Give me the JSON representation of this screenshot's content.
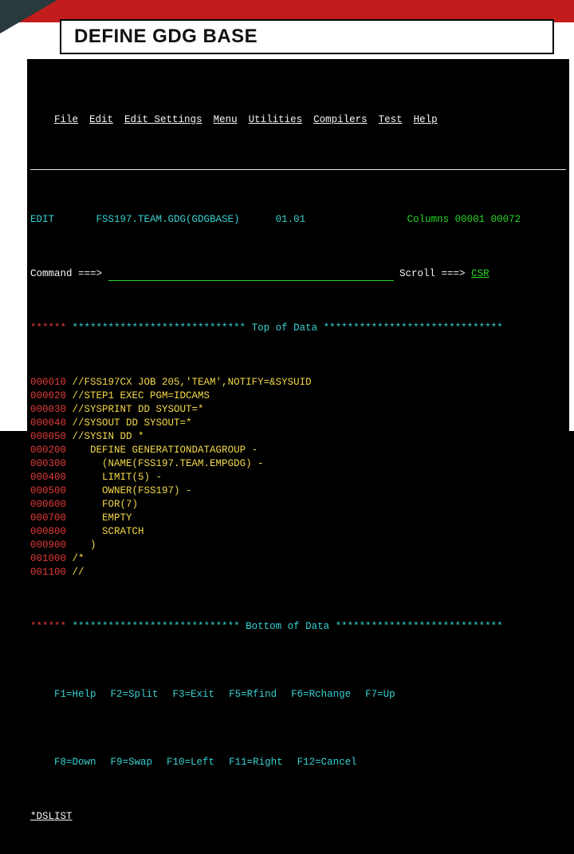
{
  "slide": {
    "title": "DEFINE GDG BASE"
  },
  "menu": {
    "file": "File",
    "edit": "Edit",
    "edit_settings": "Edit Settings",
    "menu": "Menu",
    "utilities": "Utilities",
    "compilers": "Compilers",
    "test": "Test",
    "help": "Help"
  },
  "header": {
    "mode": "EDIT",
    "dataset": "FSS197.TEAM.GDG(GDGBASE)",
    "level": "01.01",
    "columns_lbl": "Columns",
    "columns_val": "00001 00072"
  },
  "cmd": {
    "prompt": "Command ===>",
    "scroll_lbl": "Scroll ===>",
    "scroll_val": "CSR"
  },
  "markers": {
    "stars": "******",
    "top": "***************************** Top of Data ******************************",
    "bottom": "**************************** Bottom of Data ****************************"
  },
  "lines": [
    {
      "num": "000010",
      "txt": "//FSS197CX JOB 205,'TEAM',NOTIFY=&SYSUID"
    },
    {
      "num": "000020",
      "txt": "//STEP1 EXEC PGM=IDCAMS"
    },
    {
      "num": "000030",
      "txt": "//SYSPRINT DD SYSOUT=*"
    },
    {
      "num": "000040",
      "txt": "//SYSOUT DD SYSOUT=*"
    },
    {
      "num": "000050",
      "txt": "//SYSIN DD *"
    },
    {
      "num": "000200",
      "txt": "   DEFINE GENERATIONDATAGROUP -"
    },
    {
      "num": "000300",
      "txt": "     (NAME(FSS197.TEAM.EMPGDG) -"
    },
    {
      "num": "000400",
      "txt": "     LIMIT(5) -"
    },
    {
      "num": "000500",
      "txt": "     OWNER(FSS197) -"
    },
    {
      "num": "000600",
      "txt": "     FOR(7)"
    },
    {
      "num": "000700",
      "txt": "     EMPTY"
    },
    {
      "num": "000800",
      "txt": "     SCRATCH"
    },
    {
      "num": "000900",
      "txt": "   )"
    },
    {
      "num": "001000",
      "txt": "/*"
    },
    {
      "num": "001100",
      "txt": "//"
    }
  ],
  "pending": "*DSLIST",
  "fkeys": {
    "row1": {
      "f1": "F1=Help",
      "f2": "F2=Split",
      "f3": "F3=Exit",
      "f5": "F5=Rfind",
      "f6": "F6=Rchange",
      "f7": "F7=Up"
    },
    "row2": {
      "f8": "F8=Down",
      "f9": "F9=Swap",
      "f10": "F10=Left",
      "f11": "F11=Right",
      "f12": "F12=Cancel"
    }
  }
}
